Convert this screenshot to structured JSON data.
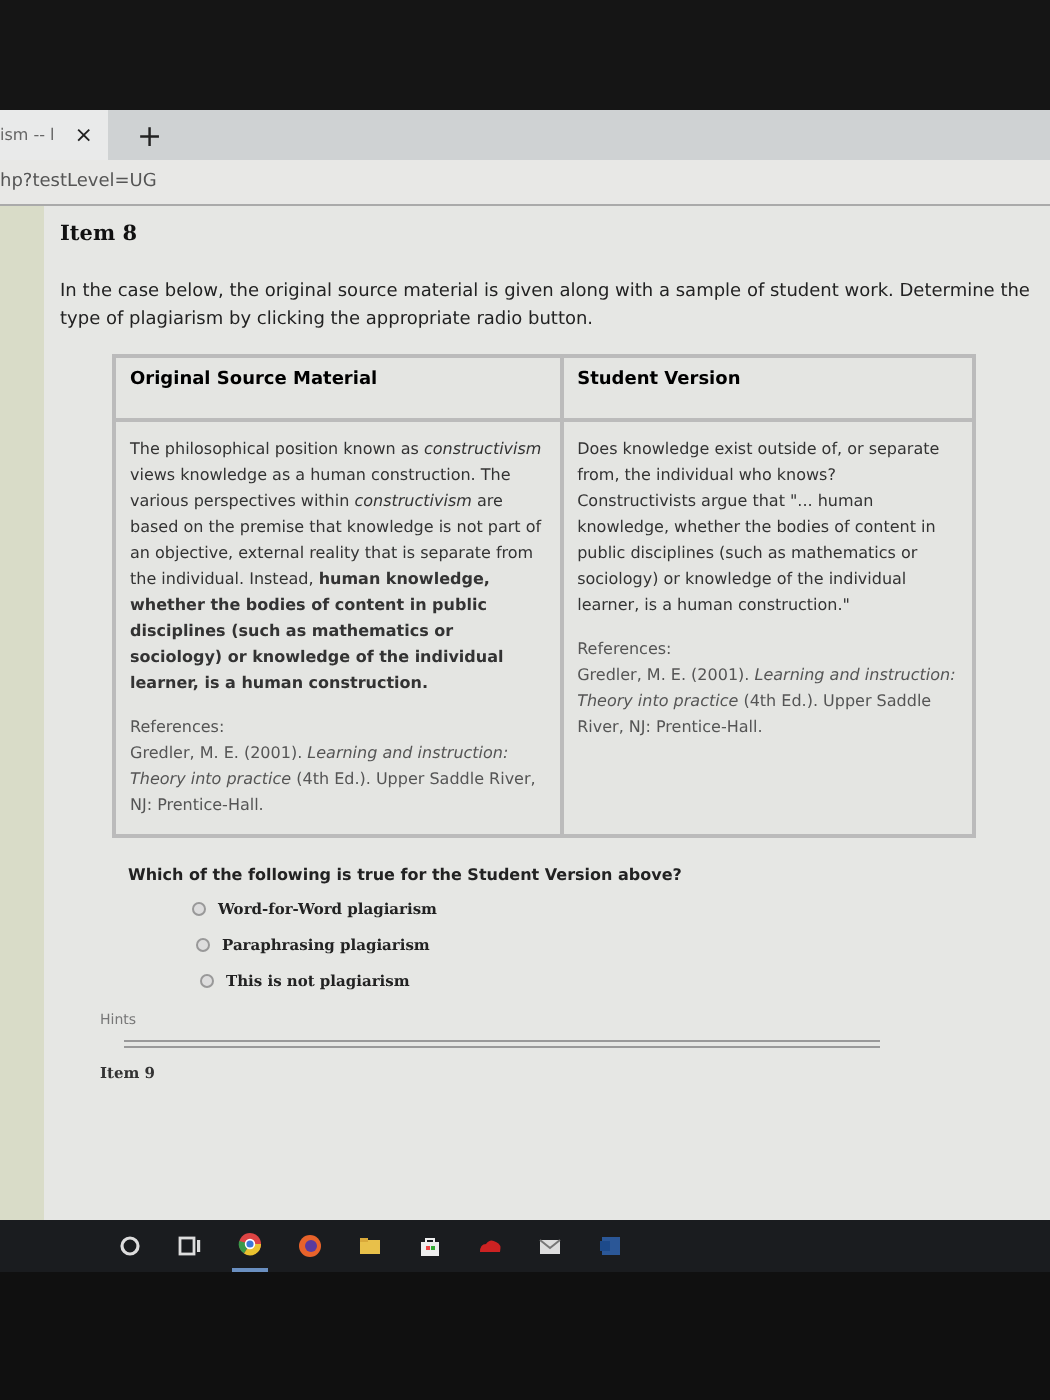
{
  "browser": {
    "tab_title": "ism -- l",
    "tab_close": "×",
    "new_tab": "+",
    "address": "hp?testLevel=UG"
  },
  "item": {
    "title": "Item 8",
    "instructions": "In the case below, the original source material is given along with a sample of student work. Determine the type of plagiarism by clicking the appropriate radio button."
  },
  "table": {
    "columns": [
      "Original Source Material",
      "Student Version"
    ],
    "cells": [
      {
        "body": "The philosophical position known as *constructivism* views knowledge as a human construction. The various perspectives within *constructivism* are based on the premise that knowledge is not part of an objective, external reality that is separate from the individual. Instead, **human knowledge, whether the bodies of content in public disciplines (such as mathematics or sociology) or knowledge of the individual learner, is a human construction.**",
        "references_label": "References:",
        "reference": "Gredler, M. E. (2001). *Learning and instruction: Theory into practice* (4th Ed.). Upper Saddle River, NJ: Prentice-Hall."
      },
      {
        "body": "Does knowledge exist outside of, or separate from, the individual who knows? Constructivists argue that \"... human knowledge, whether the bodies of content in public disciplines (such as mathematics or sociology) or knowledge of the individual learner, is a human construction.\"",
        "references_label": "References:",
        "reference": "Gredler, M. E. (2001). *Learning and instruction: Theory into practice* (4th Ed.). Upper Saddle River, NJ: Prentice-Hall."
      }
    ]
  },
  "question": {
    "prompt": "Which of the following is true for the Student Version above?",
    "options": [
      {
        "label": "Word-for-Word plagiarism",
        "selected": false
      },
      {
        "label": "Paraphrasing plagiarism",
        "selected": false
      },
      {
        "label": "This is not plagiarism",
        "selected": false
      }
    ],
    "hints": "Hints"
  },
  "next_item": "Item 9",
  "taskbar": {
    "icons": [
      {
        "kind": "circle"
      },
      {
        "kind": "taskview"
      },
      {
        "kind": "chrome",
        "active": true
      },
      {
        "kind": "firefox",
        "active": false
      },
      {
        "kind": "folder",
        "active": false
      },
      {
        "kind": "store",
        "active": false
      },
      {
        "kind": "cloud",
        "active": false
      },
      {
        "kind": "mail",
        "active": false
      },
      {
        "kind": "word",
        "active": false
      }
    ]
  }
}
